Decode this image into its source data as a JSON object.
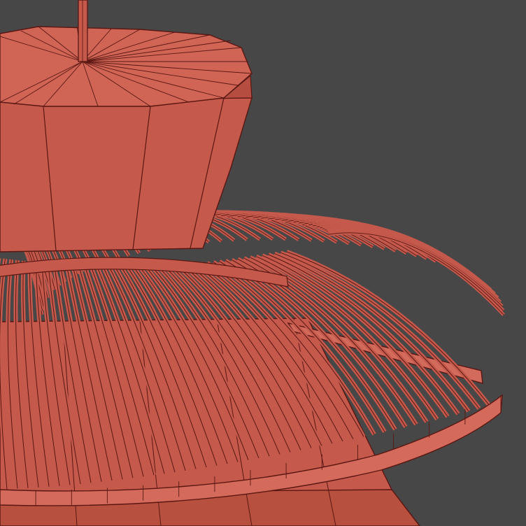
{
  "scene": {
    "subject": "wireframe-pendant-lamp-render",
    "colors": {
      "background": "#474747",
      "shade_fill": "#c4594c",
      "shade_fill_dark": "#9e3e34",
      "shade_fill_light": "#d46a5b",
      "wire_edge": "#5a1712",
      "ribbon_fill": "#d26b5c"
    },
    "upper_shade_facets": 12,
    "cage_rib_count": 48,
    "outer_ring_rib_count": 56
  }
}
